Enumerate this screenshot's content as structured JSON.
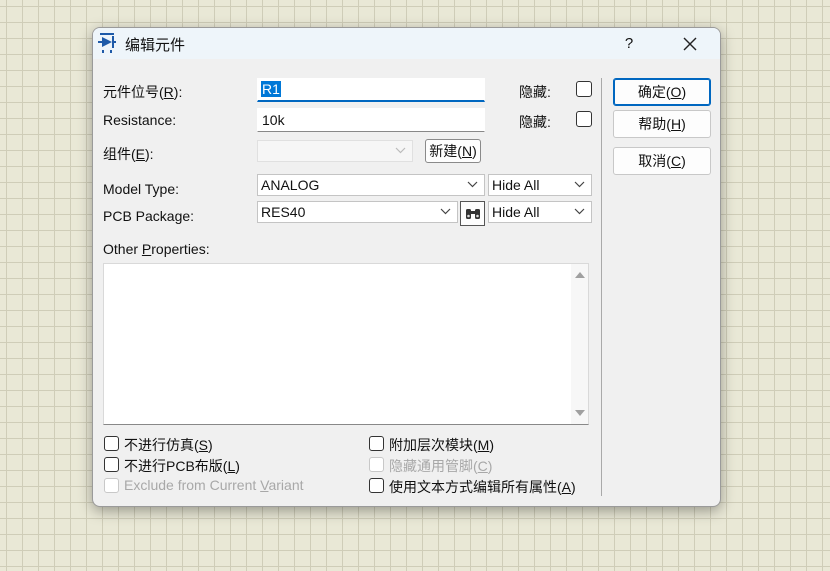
{
  "dialog": {
    "title": "编辑元件",
    "help_label": "?",
    "close_label": "✕"
  },
  "fields": {
    "ref_label_pre": "元件位号(",
    "ref_label_key": "R",
    "ref_label_post": "):",
    "ref_value": "R1",
    "resistance_label": "Resistance:",
    "resistance_value": "10k",
    "part_label_pre": "组件(",
    "part_label_key": "E",
    "part_label_post": "):",
    "part_value": "",
    "new_btn_pre": "新建(",
    "new_btn_key": "N",
    "new_btn_post": ")",
    "hidden_label": "隐藏:",
    "model_type_label": "Model Type:",
    "model_type_value": "ANALOG",
    "model_type_hide": "Hide All",
    "pcb_package_label": "PCB Package:",
    "pcb_package_value": "RES40",
    "pcb_package_hide": "Hide All",
    "other_props_pre": "Other ",
    "other_props_key": "P",
    "other_props_post": "roperties:",
    "other_props_value": ""
  },
  "buttons": {
    "ok_pre": "确定(",
    "ok_key": "O",
    "ok_post": ")",
    "help_pre": "帮助(",
    "help_key": "H",
    "help_post": ")",
    "cancel_pre": "取消(",
    "cancel_key": "C",
    "cancel_post": ")"
  },
  "options": {
    "no_sim_pre": "不进行仿真(",
    "no_sim_key": "S",
    "no_sim_post": ")",
    "no_pcb_pre": "不进行PCB布版(",
    "no_pcb_key": "L",
    "no_pcb_post": ")",
    "exclude_pre": "Exclude from Current ",
    "exclude_key": "V",
    "exclude_post": "ariant",
    "attach_pre": "附加层次模块(",
    "attach_key": "M",
    "attach_post": ")",
    "hide_pins_pre": "隐藏通用管脚(",
    "hide_pins_key": "C",
    "hide_pins_post": ")",
    "text_edit_pre": "使用文本方式编辑所有属性(",
    "text_edit_key": "A",
    "text_edit_post": ")"
  },
  "colors": {
    "accent": "#0067c0",
    "selection": "#0078d7",
    "background_grid": "#e9e8d6"
  },
  "icons": {
    "title": "component-icon",
    "browse": "binoculars-icon"
  }
}
